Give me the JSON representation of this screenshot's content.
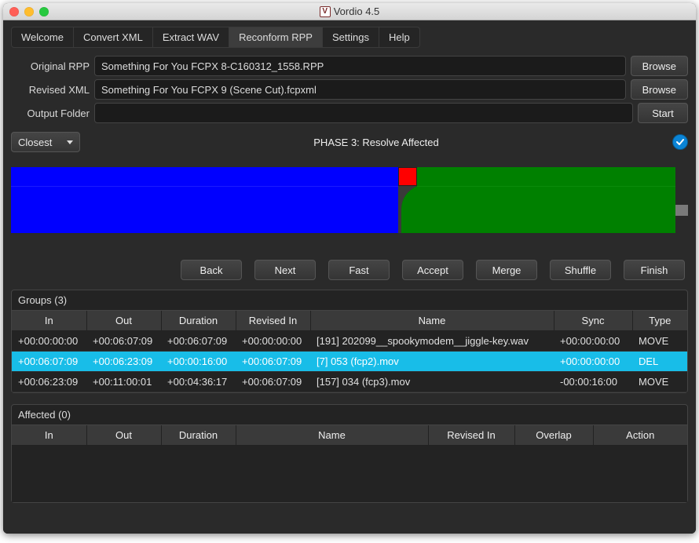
{
  "title": "Vordio 4.5",
  "tabs": [
    "Welcome",
    "Convert XML",
    "Extract WAV",
    "Reconform RPP",
    "Settings",
    "Help"
  ],
  "activeTab": 3,
  "form": {
    "originalLabel": "Original RPP",
    "originalValue": "Something For You FCPX 8-C160312_1558.RPP",
    "revisedLabel": "Revised XML",
    "revisedValue": "Something For You FCPX 9 (Scene Cut).fcpxml",
    "outputLabel": "Output Folder",
    "outputValue": "",
    "browse": "Browse",
    "start": "Start"
  },
  "dropdown": "Closest",
  "phase": "PHASE 3: Resolve Affected",
  "actions": {
    "back": "Back",
    "next": "Next",
    "fast": "Fast",
    "accept": "Accept",
    "merge": "Merge",
    "shuffle": "Shuffle",
    "finish": "Finish"
  },
  "groups": {
    "title": "Groups (3)",
    "columns": [
      "In",
      "Out",
      "Duration",
      "Revised In",
      "Name",
      "Sync",
      "Type"
    ],
    "rows": [
      {
        "in": "+00:00:00:00",
        "out": "+00:06:07:09",
        "dur": "+00:06:07:09",
        "rev": "+00:00:00:00",
        "name": "[191] 202099__spookymodem__jiggle-key.wav",
        "sync": "+00:00:00:00",
        "type": "MOVE",
        "selected": false
      },
      {
        "in": "+00:06:07:09",
        "out": "+00:06:23:09",
        "dur": "+00:00:16:00",
        "rev": "+00:06:07:09",
        "name": "[7] 053 (fcp2).mov",
        "sync": "+00:00:00:00",
        "type": "DEL",
        "selected": true
      },
      {
        "in": "+00:06:23:09",
        "out": "+00:11:00:01",
        "dur": "+00:04:36:17",
        "rev": "+00:06:07:09",
        "name": "[157] 034 (fcp3).mov",
        "sync": "-00:00:16:00",
        "type": "MOVE",
        "selected": false
      }
    ]
  },
  "affected": {
    "title": "Affected (0)",
    "columns": [
      "In",
      "Out",
      "Duration",
      "Name",
      "Revised In",
      "Overlap",
      "Action"
    ]
  }
}
